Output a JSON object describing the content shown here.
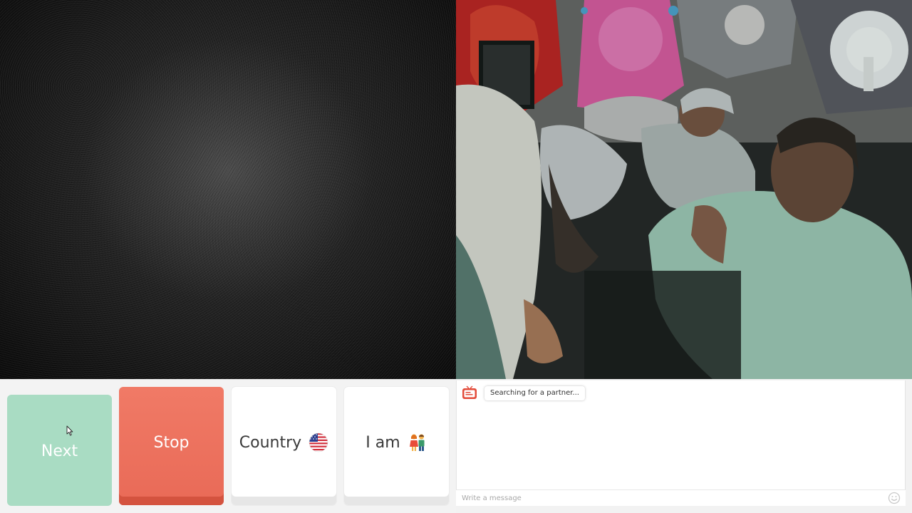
{
  "controls": {
    "next_label": "Next",
    "stop_label": "Stop",
    "country_label": "Country",
    "country_icon": "us-flag-icon",
    "iam_label": "I am",
    "iam_icon": "couple-icon"
  },
  "chat": {
    "logo_icon": "tv-logo-icon",
    "status_message": "Searching for a partner...",
    "message_placeholder": "Write a message",
    "emoji_icon": "smiley-icon"
  },
  "colors": {
    "next": "#a9dcc3",
    "stop": "#e96a57",
    "neutral_button": "#ffffff"
  }
}
